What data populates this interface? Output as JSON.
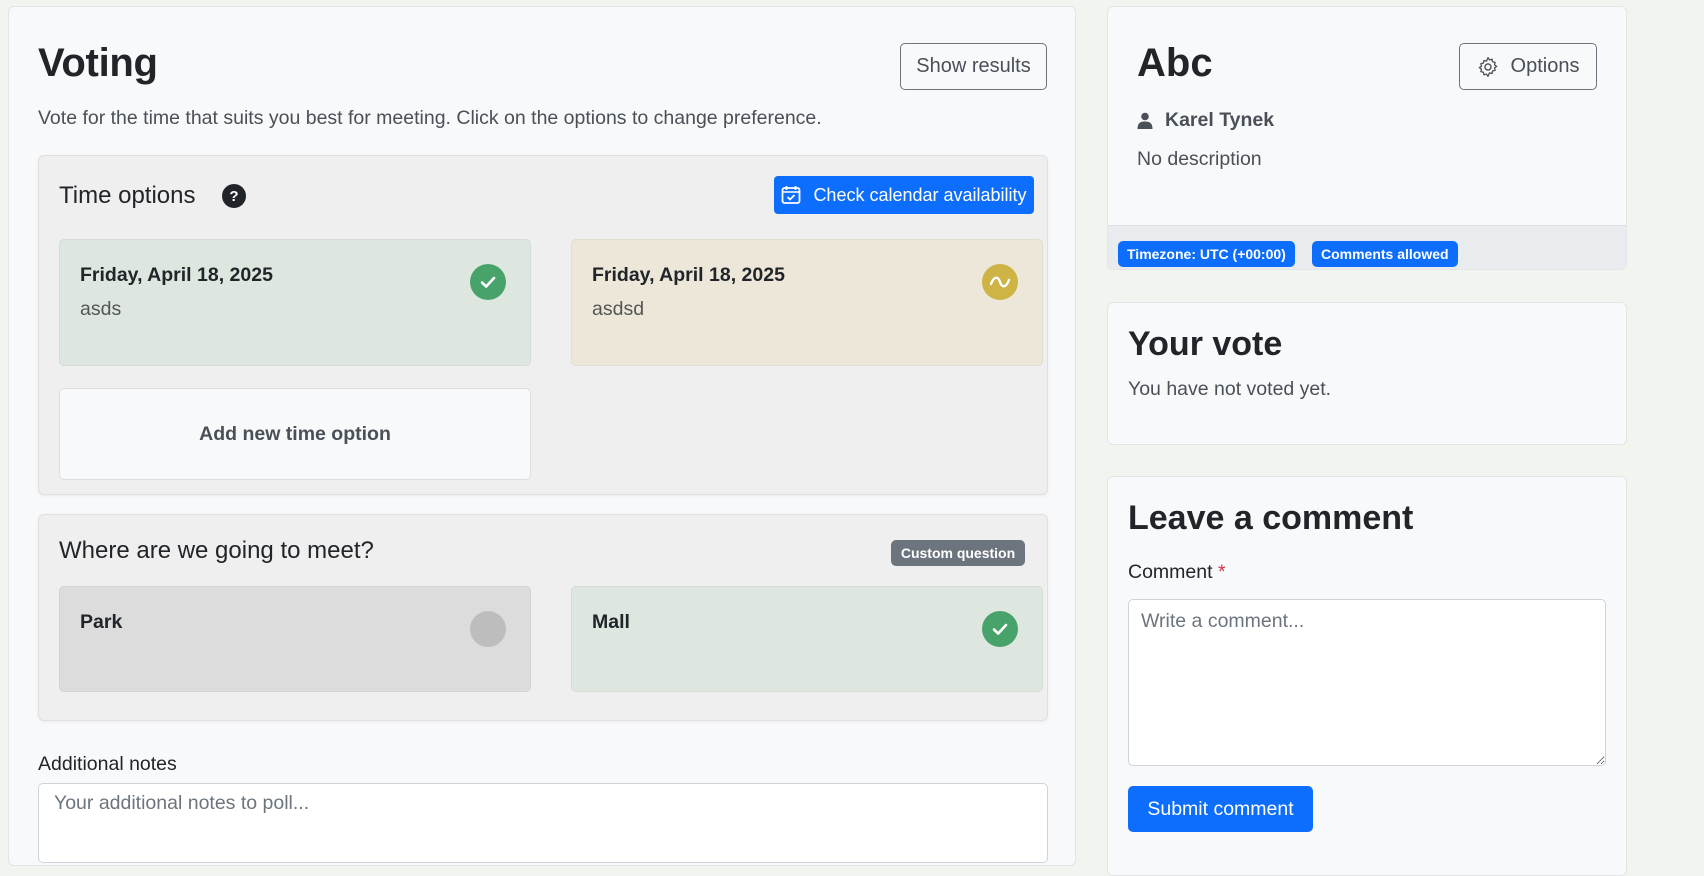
{
  "voting": {
    "title": "Voting",
    "show_results_label": "Show results",
    "intro": "Vote for the time that suits you best for meeting. Click on the options to change preference."
  },
  "time_options": {
    "title": "Time options",
    "help_glyph": "?",
    "calendar_button_label": "Check calendar availability",
    "items": [
      {
        "date": "Friday, April 18, 2025",
        "note": "asds",
        "status": "yes",
        "color": "#47a36a"
      },
      {
        "date": "Friday, April 18, 2025",
        "note": "asdsd",
        "status": "maybe",
        "color": "#cdb445"
      }
    ],
    "add_label": "Add new time option"
  },
  "question": {
    "title": "Where are we going to meet?",
    "badge": "Custom question",
    "items": [
      {
        "label": "Park",
        "status": "none",
        "color": "#bdbdbd"
      },
      {
        "label": "Mall",
        "status": "yes",
        "color": "#47a36a"
      }
    ]
  },
  "notes": {
    "label": "Additional notes",
    "placeholder": "Your additional notes to poll...",
    "value": ""
  },
  "poll": {
    "title": "Abc",
    "options_label": "Options",
    "author": "Karel Tynek",
    "description": "No description",
    "badges": [
      "Timezone: UTC (+00:00)",
      "Comments allowed"
    ]
  },
  "your_vote": {
    "title": "Your vote",
    "text": "You have not voted yet."
  },
  "comment": {
    "title": "Leave a comment",
    "label": "Comment",
    "required_mark": "*",
    "placeholder": "Write a comment...",
    "submit_label": "Submit comment"
  },
  "colors": {
    "primary": "#0d6efd",
    "yes": "#47a36a",
    "maybe": "#cdb445",
    "none": "#bdbdbd"
  }
}
